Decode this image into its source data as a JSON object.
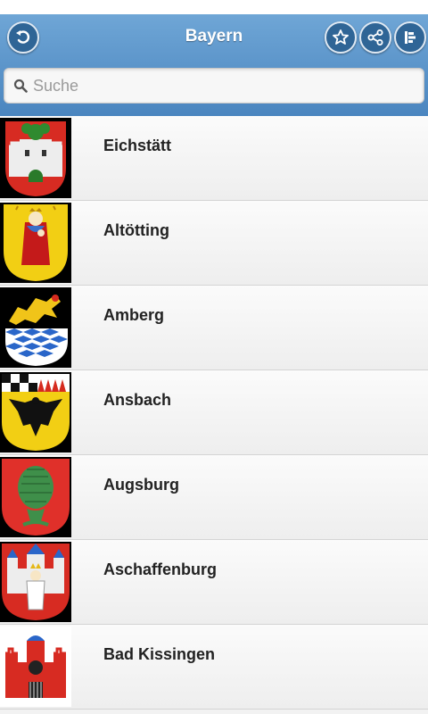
{
  "header": {
    "title": "Bayern"
  },
  "search": {
    "placeholder": "Suche"
  },
  "icons": {
    "back": "back-arrow-icon",
    "favorite": "star-icon",
    "share": "share-icon",
    "menu": "list-menu-icon",
    "search": "search-icon"
  },
  "colors": {
    "header": "#5b96cc",
    "button": "#2f6596"
  },
  "items": [
    {
      "name": "Eichstätt",
      "crest": "eichstaett-crest"
    },
    {
      "name": "Altötting",
      "crest": "altoetting-crest"
    },
    {
      "name": "Amberg",
      "crest": "amberg-crest"
    },
    {
      "name": "Ansbach",
      "crest": "ansbach-crest"
    },
    {
      "name": "Augsburg",
      "crest": "augsburg-crest"
    },
    {
      "name": "Aschaffenburg",
      "crest": "aschaffenburg-crest"
    },
    {
      "name": "Bad Kissingen",
      "crest": "bad-kissingen-crest"
    }
  ]
}
